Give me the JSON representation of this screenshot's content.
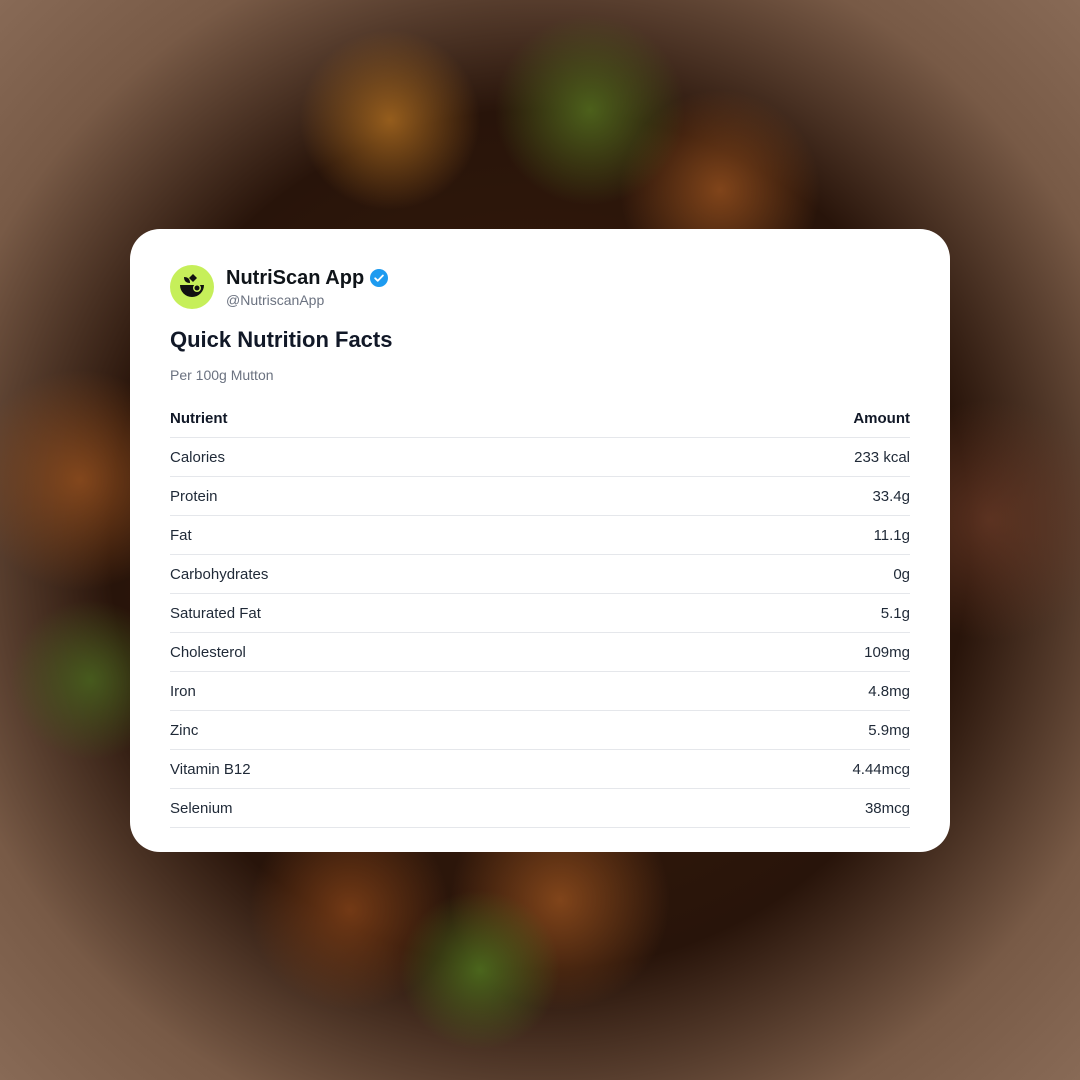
{
  "profile": {
    "name": "NutriScan App",
    "handle": "@NutriscanApp",
    "avatar_icon": "leaf-bowl-icon",
    "verified_icon": "verified-badge-icon",
    "accent_color": "#c6ef5a",
    "verified_color": "#1d9bf0"
  },
  "card": {
    "title": "Quick Nutrition Facts",
    "subtitle": "Per 100g Mutton"
  },
  "table": {
    "headers": {
      "nutrient": "Nutrient",
      "amount": "Amount"
    },
    "rows": [
      {
        "nutrient": "Calories",
        "amount": "233 kcal"
      },
      {
        "nutrient": "Protein",
        "amount": "33.4g"
      },
      {
        "nutrient": "Fat",
        "amount": "11.1g"
      },
      {
        "nutrient": "Carbohydrates",
        "amount": "0g"
      },
      {
        "nutrient": "Saturated Fat",
        "amount": "5.1g"
      },
      {
        "nutrient": "Cholesterol",
        "amount": "109mg"
      },
      {
        "nutrient": "Iron",
        "amount": "4.8mg"
      },
      {
        "nutrient": "Zinc",
        "amount": "5.9mg"
      },
      {
        "nutrient": "Vitamin B12",
        "amount": "4.44mcg"
      },
      {
        "nutrient": "Selenium",
        "amount": "38mcg"
      }
    ]
  }
}
